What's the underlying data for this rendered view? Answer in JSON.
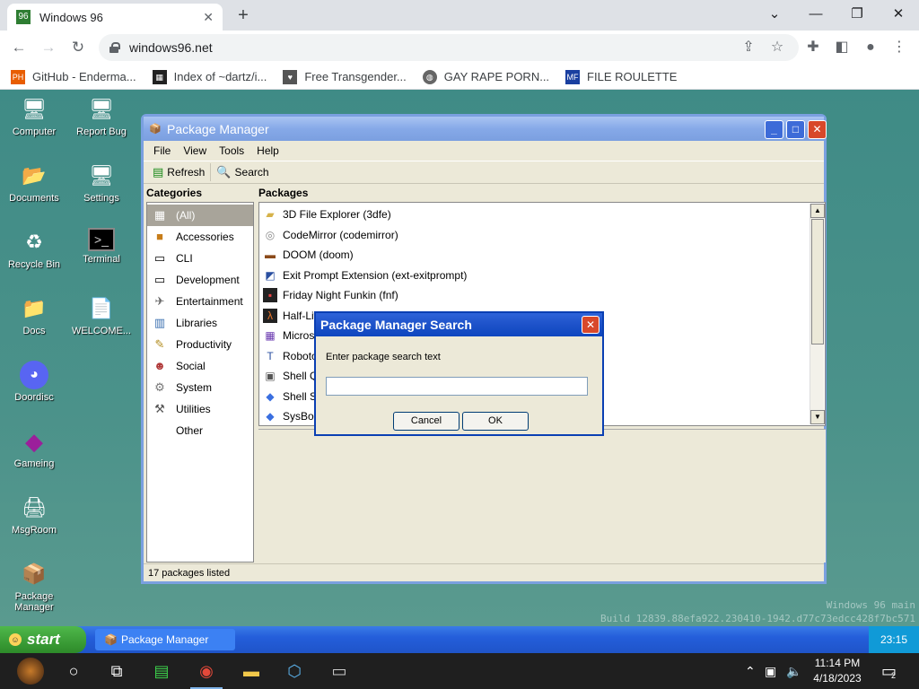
{
  "browser": {
    "tab_title": "Windows 96",
    "url": "windows96.net",
    "bookmarks": [
      {
        "label": "GitHub - Enderma...",
        "icon": "PH"
      },
      {
        "label": "Index of ~dartz/i...",
        "icon": "dartz"
      },
      {
        "label": "Free Transgender...",
        "icon": "heart"
      },
      {
        "label": "GAY RAPE PORN...",
        "icon": "globe"
      },
      {
        "label": "FILE ROULETTE",
        "icon": "MF"
      }
    ]
  },
  "desktop": {
    "icons": [
      {
        "label": "Computer",
        "glyph": "🖥"
      },
      {
        "label": "Report Bug",
        "glyph": "🖥"
      },
      {
        "label": "Documents",
        "glyph": "📂"
      },
      {
        "label": "Settings",
        "glyph": "🖥"
      },
      {
        "label": "Recycle Bin",
        "glyph": "♻"
      },
      {
        "label": "Terminal",
        "glyph": "▣"
      },
      {
        "label": "Docs",
        "glyph": "📁"
      },
      {
        "label": "WELCOME...",
        "glyph": "📄"
      },
      {
        "label": "Doordisc",
        "glyph": "💬"
      },
      {
        "label": "Gameing",
        "glyph": "◆"
      },
      {
        "label": "MsgRoom",
        "glyph": "🖨"
      },
      {
        "label": "Package Manager",
        "glyph": "📦"
      }
    ],
    "watermark_line1": "Windows 96 main",
    "watermark_line2": "Build 12839.88efa922.230410-1942.d77c73edcc428f7bc571"
  },
  "package_manager": {
    "title": "Package Manager",
    "menu": [
      "File",
      "View",
      "Tools",
      "Help"
    ],
    "toolbar": {
      "refresh": "Refresh",
      "search": "Search"
    },
    "categories_header": "Categories",
    "packages_header": "Packages",
    "categories": [
      {
        "label": "(All)",
        "icon": "all",
        "selected": true
      },
      {
        "label": "Accessories",
        "icon": "box"
      },
      {
        "label": "CLI",
        "icon": "window"
      },
      {
        "label": "Development",
        "icon": "window"
      },
      {
        "label": "Entertainment",
        "icon": "plane"
      },
      {
        "label": "Libraries",
        "icon": "books"
      },
      {
        "label": "Productivity",
        "icon": "pencil"
      },
      {
        "label": "Social",
        "icon": "people"
      },
      {
        "label": "System",
        "icon": "gear"
      },
      {
        "label": "Utilities",
        "icon": "tools"
      },
      {
        "label": "Other",
        "icon": "blank"
      }
    ],
    "packages": [
      {
        "label": "3D File Explorer (3dfe)",
        "icon": "folder"
      },
      {
        "label": "CodeMirror (codemirror)",
        "icon": "disc"
      },
      {
        "label": "DOOM (doom)",
        "icon": "doom"
      },
      {
        "label": "Exit Prompt Extension (ext-exitprompt)",
        "icon": "cube"
      },
      {
        "label": "Friday Night Funkin (fnf)",
        "icon": "fnf"
      },
      {
        "label": "Half-Life",
        "icon": "lambda"
      },
      {
        "label": "Microsof",
        "icon": "ms"
      },
      {
        "label": "Roboto F",
        "icon": "font"
      },
      {
        "label": "Shell Qui",
        "icon": "shell"
      },
      {
        "label": "Shell Swi",
        "icon": "diamond"
      },
      {
        "label": "SysBox (",
        "icon": "diamond"
      }
    ],
    "status": "17 packages listed"
  },
  "search_dialog": {
    "title": "Package Manager Search",
    "prompt": "Enter package search text",
    "input_value": "",
    "cancel_label": "Cancel",
    "ok_label": "OK"
  },
  "w96_taskbar": {
    "start_label": "start",
    "task_label": "Package Manager",
    "clock": "23:15"
  },
  "windows_taskbar": {
    "time": "11:14 PM",
    "date": "4/18/2023",
    "notification_count": "2"
  }
}
